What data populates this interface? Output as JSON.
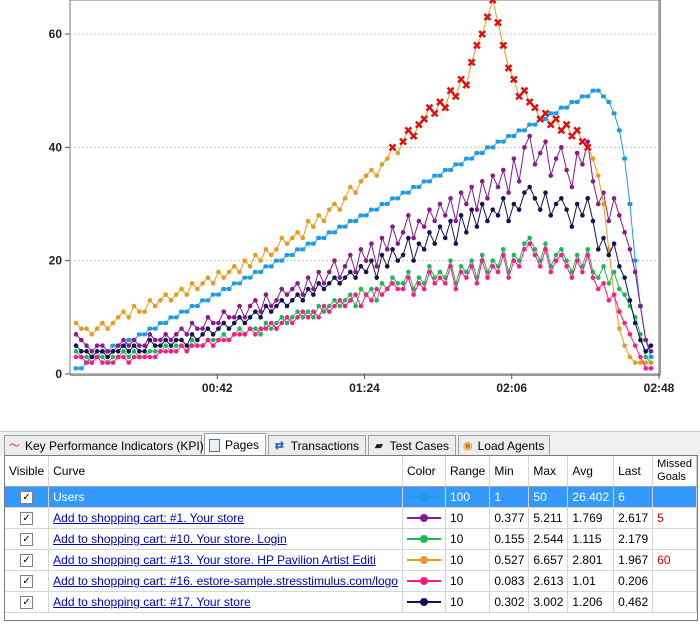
{
  "chart_data": {
    "type": "line",
    "x_ticks": [
      "00:42",
      "01:24",
      "02:06",
      "02:48"
    ],
    "y_ticks": [
      "0",
      "20",
      "40",
      "60"
    ],
    "ylim": [
      0,
      66
    ],
    "grid": true,
    "missed_goal_marker": "red-x-icon",
    "series": [
      {
        "name": "Users",
        "color": "#1e9be8",
        "values": [
          1,
          1,
          2,
          3,
          3,
          4,
          4,
          5,
          5,
          5,
          6,
          6,
          7,
          7,
          8,
          8,
          9,
          9,
          10,
          10,
          11,
          11,
          12,
          12,
          13,
          13,
          14,
          14,
          15,
          15,
          16,
          16,
          17,
          17,
          18,
          18,
          19,
          19,
          20,
          20,
          21,
          21,
          22,
          22,
          23,
          23,
          24,
          24,
          25,
          25,
          26,
          26,
          27,
          27,
          28,
          28,
          29,
          29,
          30,
          30,
          31,
          31,
          32,
          32,
          33,
          33,
          34,
          34,
          35,
          35,
          36,
          36,
          37,
          37,
          38,
          38,
          39,
          39,
          40,
          40,
          41,
          41,
          42,
          42,
          43,
          43,
          44,
          44,
          45,
          45,
          46,
          46,
          47,
          47,
          48,
          48,
          49,
          49,
          50,
          50,
          49,
          48,
          46,
          43,
          38,
          30,
          20,
          12,
          6,
          3
        ]
      },
      {
        "name": "Add to shopping cart: #1. Your store",
        "color": "#8b1a8b",
        "values": [
          7,
          6,
          5,
          4,
          5,
          5,
          4,
          4,
          5,
          6,
          5,
          6,
          5,
          5,
          7,
          6,
          6,
          7,
          6,
          7,
          8,
          7,
          9,
          8,
          8,
          10,
          9,
          9,
          11,
          10,
          10,
          12,
          10,
          12,
          13,
          11,
          14,
          12,
          13,
          15,
          14,
          15,
          16,
          14,
          17,
          15,
          18,
          16,
          18,
          20,
          17,
          19,
          21,
          18,
          22,
          20,
          23,
          19,
          24,
          22,
          26,
          23,
          25,
          28,
          24,
          27,
          26,
          29,
          27,
          30,
          28,
          31,
          27,
          32,
          30,
          33,
          29,
          34,
          31,
          35,
          33,
          36,
          32,
          38,
          34,
          40,
          42,
          37,
          39,
          41,
          35,
          38,
          40,
          36,
          33,
          39,
          37,
          41,
          34,
          30,
          32,
          27,
          31,
          28,
          25,
          22,
          18,
          12,
          6,
          4
        ]
      },
      {
        "name": "Add to shopping cart: #10. Your store. Login",
        "color": "#1db954",
        "values": [
          4,
          3,
          3,
          2,
          3,
          3,
          2,
          3,
          3,
          4,
          3,
          4,
          3,
          3,
          4,
          4,
          4,
          5,
          4,
          5,
          5,
          4,
          6,
          5,
          5,
          6,
          6,
          6,
          7,
          6,
          7,
          8,
          7,
          8,
          8,
          7,
          9,
          8,
          9,
          10,
          9,
          10,
          11,
          10,
          11,
          10,
          12,
          11,
          12,
          13,
          12,
          13,
          14,
          12,
          15,
          14,
          15,
          13,
          16,
          15,
          17,
          16,
          16,
          18,
          15,
          17,
          16,
          19,
          17,
          18,
          17,
          20,
          16,
          19,
          18,
          20,
          17,
          21,
          18,
          20,
          19,
          22,
          18,
          21,
          20,
          23,
          24,
          22,
          20,
          23,
          19,
          21,
          22,
          20,
          18,
          21,
          19,
          22,
          18,
          17,
          19,
          16,
          18,
          15,
          14,
          12,
          10,
          7,
          3,
          2
        ]
      },
      {
        "name": "Add to shopping cart: #13. Your store. HP Pavilion Artist Editi",
        "color": "#e89a1e",
        "values": [
          9,
          8,
          8,
          7,
          8,
          9,
          8,
          9,
          10,
          11,
          10,
          12,
          11,
          11,
          13,
          12,
          13,
          14,
          13,
          14,
          15,
          14,
          16,
          15,
          16,
          17,
          16,
          18,
          17,
          18,
          19,
          18,
          20,
          19,
          21,
          20,
          22,
          21,
          22,
          24,
          23,
          24,
          25,
          24,
          27,
          26,
          28,
          27,
          29,
          30,
          29,
          31,
          33,
          32,
          34,
          35,
          36,
          35,
          37,
          38,
          40,
          39,
          41,
          43,
          42,
          44,
          45,
          47,
          46,
          48,
          47,
          50,
          49,
          52,
          51,
          55,
          58,
          60,
          63,
          66,
          62,
          58,
          54,
          52,
          49,
          50,
          48,
          47,
          45,
          46,
          44,
          45,
          43,
          44,
          42,
          43,
          41,
          40,
          38,
          35,
          30,
          22,
          14,
          8,
          5,
          3,
          2,
          2,
          2,
          2
        ]
      },
      {
        "name": "Add to shopping cart: #16. estore-sample.stresstimulus.com/logo",
        "color": "#ff1a8c",
        "values": [
          3,
          3,
          2,
          2,
          3,
          2,
          2,
          2,
          3,
          3,
          2,
          3,
          3,
          3,
          3,
          3,
          4,
          4,
          4,
          4,
          5,
          4,
          5,
          5,
          5,
          6,
          5,
          6,
          6,
          6,
          7,
          7,
          7,
          8,
          7,
          8,
          8,
          9,
          8,
          9,
          10,
          9,
          10,
          11,
          10,
          11,
          10,
          12,
          11,
          12,
          13,
          12,
          13,
          14,
          12,
          14,
          13,
          15,
          14,
          15,
          16,
          15,
          15,
          17,
          14,
          16,
          15,
          18,
          16,
          17,
          16,
          19,
          15,
          18,
          17,
          19,
          16,
          20,
          17,
          19,
          18,
          21,
          17,
          20,
          19,
          22,
          23,
          21,
          19,
          22,
          18,
          20,
          21,
          19,
          17,
          20,
          18,
          21,
          17,
          15,
          16,
          13,
          14,
          11,
          9,
          7,
          5,
          3,
          1,
          1
        ]
      },
      {
        "name": "Add to shopping cart: #17. Your store",
        "color": "#141450",
        "values": [
          5,
          4,
          4,
          3,
          4,
          4,
          3,
          4,
          4,
          5,
          4,
          5,
          4,
          4,
          6,
          5,
          5,
          6,
          5,
          6,
          6,
          5,
          7,
          6,
          7,
          8,
          7,
          8,
          9,
          8,
          9,
          10,
          9,
          10,
          11,
          10,
          12,
          11,
          12,
          13,
          12,
          13,
          14,
          13,
          15,
          14,
          16,
          15,
          16,
          17,
          16,
          17,
          18,
          17,
          19,
          18,
          20,
          17,
          21,
          19,
          22,
          20,
          21,
          24,
          20,
          23,
          22,
          25,
          23,
          26,
          24,
          27,
          23,
          28,
          25,
          29,
          26,
          30,
          27,
          29,
          28,
          31,
          27,
          30,
          29,
          32,
          33,
          31,
          29,
          32,
          28,
          30,
          31,
          29,
          26,
          30,
          28,
          31,
          27,
          22,
          24,
          21,
          23,
          19,
          17,
          13,
          9,
          6,
          4,
          5
        ]
      }
    ]
  },
  "tabs": {
    "kpi": "Key Performance Indicators (KPI)",
    "pages": "Pages",
    "transactions": "Transactions",
    "test_cases": "Test Cases",
    "load_agents": "Load Agents"
  },
  "columns": {
    "visible": "Visible",
    "curve": "Curve",
    "color": "Color",
    "range": "Range",
    "min": "Min",
    "max": "Max",
    "avg": "Avg",
    "last": "Last",
    "missed_goals": "Missed Goals"
  },
  "rows": [
    {
      "visible": "✓",
      "curve": "Users",
      "color": "#1e9be8",
      "range": "100",
      "min": "1",
      "max": "50",
      "avg": "26.402",
      "last": "6",
      "missed": ""
    },
    {
      "visible": "✓",
      "curve": "Add to shopping cart: #1. Your store",
      "color": "#8b1a8b",
      "range": "10",
      "min": "0.377",
      "max": "5.211",
      "avg": "1.769",
      "last": "2.617",
      "missed": "5"
    },
    {
      "visible": "✓",
      "curve": "Add to shopping cart: #10. Your store. Login",
      "color": "#1db954",
      "range": "10",
      "min": "0.155",
      "max": "2.544",
      "avg": "1.115",
      "last": "2.179",
      "missed": ""
    },
    {
      "visible": "✓",
      "curve": "Add to shopping cart: #13. Your store. HP Pavilion Artist Editi",
      "color": "#e89a1e",
      "range": "10",
      "min": "0.527",
      "max": "6.657",
      "avg": "2.801",
      "last": "1.967",
      "missed": "60"
    },
    {
      "visible": "✓",
      "curve": "Add to shopping cart: #16. estore-sample.stresstimulus.com/logo",
      "color": "#ff1a8c",
      "range": "10",
      "min": "0.083",
      "max": "2.613",
      "avg": "1.01",
      "last": "0.206",
      "missed": ""
    },
    {
      "visible": "✓",
      "curve": "Add to shopping cart: #17. Your store",
      "color": "#141450",
      "range": "10",
      "min": "0.302",
      "max": "3.002",
      "avg": "1.206",
      "last": "0.462",
      "missed": ""
    }
  ]
}
